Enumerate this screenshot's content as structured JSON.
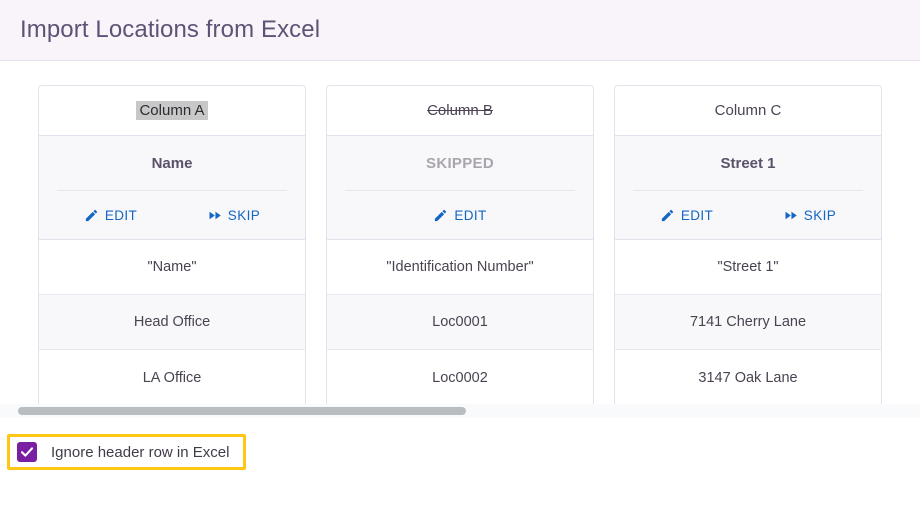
{
  "header": {
    "title": "Import Locations from Excel"
  },
  "columns": [
    {
      "source_header": "Column A",
      "source_state": "selected",
      "mapped_to": "Name",
      "mapped_state": "mapped",
      "actions": [
        {
          "label": "EDIT",
          "icon": "pencil-icon"
        },
        {
          "label": "SKIP",
          "icon": "skip-next-icon"
        }
      ],
      "rows": [
        "\"Name\"",
        "Head Office",
        "LA Office"
      ]
    },
    {
      "source_header": "Column B",
      "source_state": "struck",
      "mapped_to": "SKIPPED",
      "mapped_state": "skipped",
      "actions": [
        {
          "label": "EDIT",
          "icon": "pencil-icon"
        }
      ],
      "rows": [
        "\"Identification Number\"",
        "Loc0001",
        "Loc0002"
      ]
    },
    {
      "source_header": "Column C",
      "source_state": "normal",
      "mapped_to": "Street 1",
      "mapped_state": "mapped",
      "actions": [
        {
          "label": "EDIT",
          "icon": "pencil-icon"
        },
        {
          "label": "SKIP",
          "icon": "skip-next-icon"
        }
      ],
      "rows": [
        "\"Street 1\"",
        "7141 Cherry Lane",
        "3147 Oak Lane"
      ]
    }
  ],
  "footer": {
    "ignore_header_checkbox": {
      "label": "Ignore header row in Excel",
      "checked": true,
      "highlighted": true
    }
  },
  "scrollbar": {
    "orientation": "horizontal",
    "thumb_fraction": 0.5
  },
  "colors": {
    "header_band": "#f9f4f9",
    "title_text": "#5f5277",
    "action_link": "#1266c4",
    "checkbox_fill": "#7b1fa2",
    "highlight_border": "#ffc711",
    "card_border": "#e6e0ec",
    "alt_row": "#f8f7f9"
  }
}
